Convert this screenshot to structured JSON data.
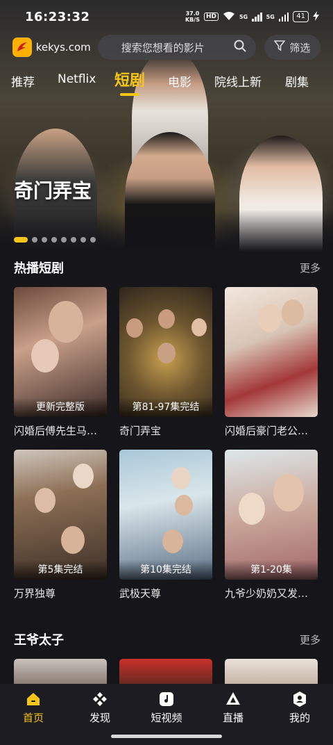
{
  "status_bar": {
    "time": "16:23:32",
    "net_speed_value": "37.0",
    "net_speed_unit": "KB/S",
    "hd_badge": "HD",
    "sim1_label": "5G",
    "sim2_label": "5G",
    "battery": "41"
  },
  "app": {
    "site_name": "kekys.com",
    "search_placeholder": "搜索您想看的影片",
    "filter_label": "筛选"
  },
  "tabs": [
    {
      "label": "推荐"
    },
    {
      "label": "Netflix"
    },
    {
      "label": "短剧"
    },
    {
      "label": "电影"
    },
    {
      "label": "院线上新"
    },
    {
      "label": "剧集"
    }
  ],
  "active_tab": "短剧",
  "hero": {
    "title": "奇门弄宝",
    "slide_count": 8,
    "active_slide": 1
  },
  "sections": [
    {
      "title": "热播短剧",
      "more_label": "更多",
      "items": [
        {
          "title": "闪婚后傅先生马上封神",
          "badge": "更新完整版"
        },
        {
          "title": "奇门弄宝",
          "badge": "第81-97集完结"
        },
        {
          "title": "闪婚后豪门老公马甲藏不住了",
          "badge": ""
        },
        {
          "title": "万界独尊",
          "badge": "第5集完结"
        },
        {
          "title": "武极天尊",
          "badge": "第10集完结"
        },
        {
          "title": "九爷少奶奶又发飙了",
          "badge": "第1-20集"
        }
      ]
    },
    {
      "title": "王爷太子",
      "more_label": "更多",
      "items": []
    }
  ],
  "bottom_nav": [
    {
      "label": "首页",
      "icon": "home-icon",
      "active": true
    },
    {
      "label": "发现",
      "icon": "discover-icon",
      "active": false
    },
    {
      "label": "短视频",
      "icon": "short-video-icon",
      "active": false
    },
    {
      "label": "直播",
      "icon": "live-icon",
      "active": false
    },
    {
      "label": "我的",
      "icon": "profile-icon",
      "active": false
    }
  ],
  "colors": {
    "accent": "#f5c518",
    "background": "#15151a",
    "nav_background": "#1c1c22"
  }
}
